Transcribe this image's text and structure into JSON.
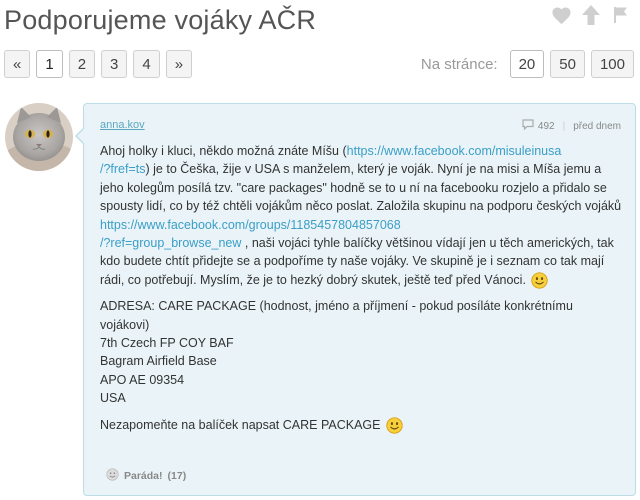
{
  "page": {
    "title": "Podporujeme vojáky AČR"
  },
  "icons": {
    "like": "heart-icon",
    "upvote": "arrow-up-icon",
    "flag": "flag-icon"
  },
  "pagination": {
    "prev": "«",
    "pages": [
      "1",
      "2",
      "3",
      "4"
    ],
    "active_page": "1",
    "next": "»"
  },
  "per_page": {
    "label": "Na stránce:",
    "options": [
      "20",
      "50",
      "100"
    ],
    "active": "20"
  },
  "post": {
    "author": "anna.kov",
    "comment_count": "492",
    "time": "před dnem",
    "text": {
      "p1_a": "Ahoj holky i kluci, někdo možná znáte Míšu (",
      "p1_link1": "https://www.facebook.com/misuleinusa/?fref=ts",
      "p1_link1_l1": "https://www.facebook.com/misuleinusa",
      "p1_link1_l2": "/?fref=ts",
      "p1_b": ") je to Češka, žije v USA s manželem, který je voják. Nyní je na misi a Míša jemu a jeho kolegům posílá tzv. \"care packages\" hodně se to u ní na facebooku rozjelo a přidalo se spousty lidí, co by též chtěli vojákům něco poslat. Založila skupinu na podporu českých vojáků ",
      "p1_link2_l1": "https://www.facebook.com/groups/1185457804857068",
      "p1_link2_l2": "/?ref=group_browse_new",
      "p1_c": " , naši vojáci tyhle balíčky většinou vídají jen u těch amerických, tak kdo budete chtít přidejte se a podpoříme ty naše vojáky. Ve skupině je i seznam co tak mají rádi, co potřebují. Myslím, že je to hezký dobrý skutek, ještě teď před Vánoci.",
      "address_1": "ADRESA: CARE PACKAGE (hodnost, jméno a příjmení - pokud posíláte konkrétnímu vojákovi)",
      "address_2": "7th Czech FP COY BAF",
      "address_3": "Bagram Airfield Base",
      "address_4": "APO AE 09354",
      "address_5": "USA",
      "closing": "Nezapomeňte na balíček napsat CARE PACKAGE"
    },
    "reaction": {
      "label": "Paráda!",
      "count": "(17)"
    }
  },
  "colors": {
    "bubble_bg": "#eaf4f8",
    "bubble_border": "#bcdde6",
    "link": "#3a9ec7",
    "author": "#5aa8c0"
  }
}
